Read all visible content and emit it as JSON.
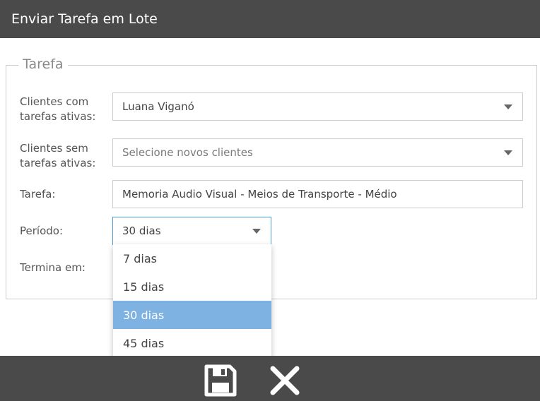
{
  "dialog": {
    "title": "Enviar Tarefa em Lote"
  },
  "fieldset": {
    "legend": "Tarefa"
  },
  "form": {
    "clientes_com": {
      "label_line1": "Clientes com",
      "label_line2": "tarefas ativas:",
      "value": "Luana Viganó"
    },
    "clientes_sem": {
      "label_line1": "Clientes sem",
      "label_line2": "tarefas ativas:",
      "placeholder": "Selecione novos clientes"
    },
    "tarefa": {
      "label": "Tarefa:",
      "value": "Memoria Audio Visual  - Meios de Transporte - Médio"
    },
    "periodo": {
      "label": "Período:",
      "value": "30 dias",
      "options": [
        "7 dias",
        "15 dias",
        "30 dias",
        "45 dias"
      ],
      "selected_index": 2
    },
    "termina": {
      "label": "Termina em:"
    }
  },
  "footer": {
    "save_icon": "save-icon",
    "close_icon": "close-icon"
  },
  "colors": {
    "header_bg": "#4a4a4a",
    "selected_option_bg": "#7eb2e2",
    "focus_border": "#4a9bd8"
  }
}
